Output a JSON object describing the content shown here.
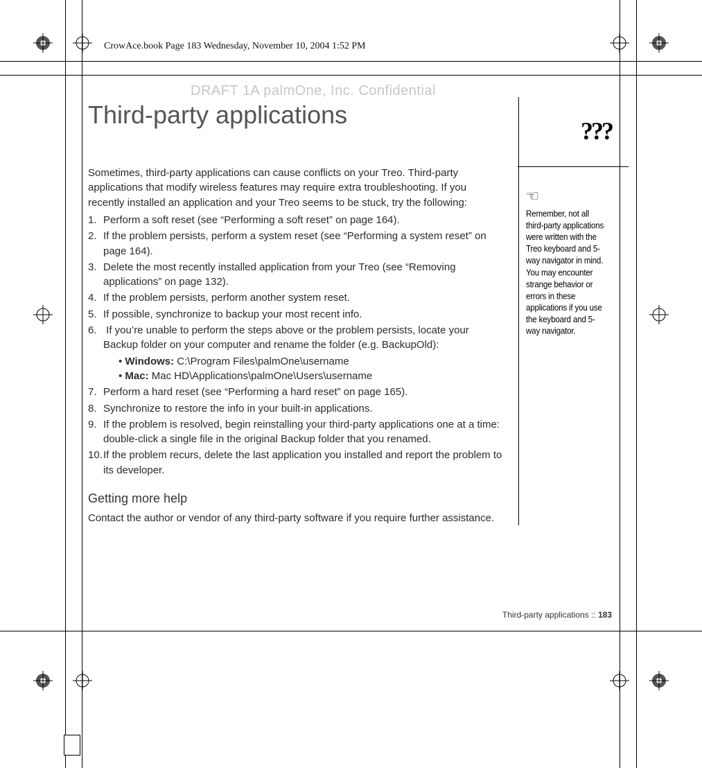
{
  "header": {
    "running": "CrowAce.book  Page 183  Wednesday, November 10, 2004  1:52 PM"
  },
  "draft_stamp": "DRAFT 1A  palmOne, Inc.   Confidential",
  "title": "Third-party applications",
  "intro": "Sometimes, third-party applications can cause conflicts on your Treo. Third-party applications that modify wireless features may require extra troubleshooting. If you recently installed an application and your Treo seems to be stuck, try the following:",
  "steps": [
    "Perform a soft reset (see “Performing a soft reset” on page 164).",
    "If the problem persists, perform a system reset (see “Performing a system reset” on page 164).",
    "Delete the most recently installed application from your Treo (see “Removing applications” on page 132).",
    "If the problem persists, perform another system reset.",
    "If possible, synchronize to backup your most recent info.",
    "If you’re unable to perform the steps above or the problem persists, locate your Backup folder on your computer and rename the folder (e.g. BackupOld):",
    "Perform a hard reset (see “Performing a hard reset” on page 165).",
    "Synchronize to restore the info in your built-in applications.",
    "If the problem is resolved, begin reinstalling your third-party applications one at a time: double-click a single file in the original Backup folder that you renamed.",
    "If the problem recurs, delete the last application you installed and report the problem to its developer."
  ],
  "sub_bullets": {
    "win_label": "Windows:",
    "win_path": " C:\\Program Files\\palmOne\\username",
    "mac_label": "Mac:",
    "mac_path": " Mac HD\\Applications\\palmOne\\Users\\username"
  },
  "subhead": "Getting more help",
  "help_text": "Contact the author or vendor of any third-party software if you require further assistance.",
  "side": {
    "qmarks": "???",
    "note": "Remember, not all third-party applications were written with the Treo keyboard and 5-way navigator in mind. You may encounter strange behavior or errors in these applications if you use the keyboard and 5-way navigator."
  },
  "footer": {
    "label": "Third-party applications   ::   ",
    "page": "183"
  }
}
